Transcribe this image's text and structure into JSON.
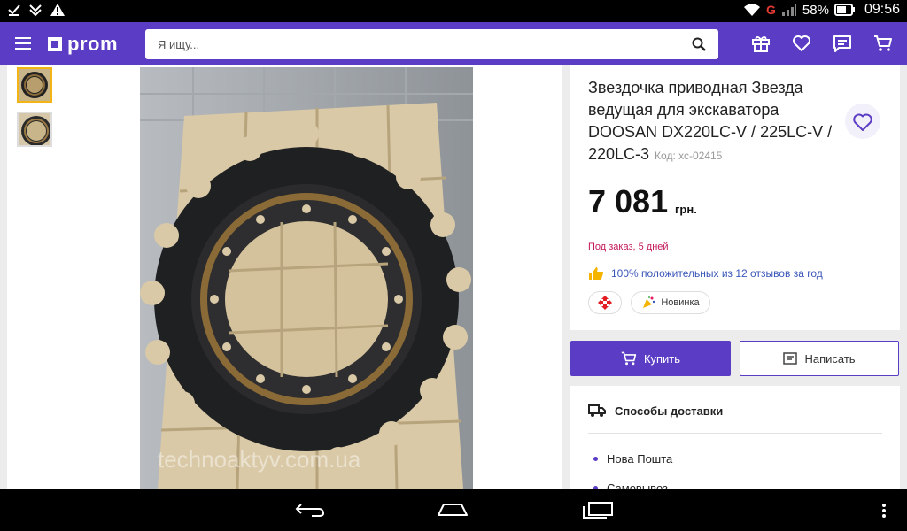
{
  "status_bar": {
    "battery": "58%",
    "time": "09:56",
    "network": "G"
  },
  "header": {
    "logo": "prom",
    "search": {
      "placeholder": "Я ищу..."
    },
    "icons": [
      "menu-icon",
      "gift-icon",
      "heart-icon",
      "chat-icon",
      "cart-icon"
    ],
    "accent_color": "#5b3cc4"
  },
  "gallery": {
    "thumbnails": [
      "sprocket-photo-1",
      "sprocket-photo-2"
    ],
    "watermark": "technoaktyv.com.ua"
  },
  "product": {
    "title": "Звездочка приводная Звезда ведущая для экскаватора DOOSAN DX220LC-V / 225LC-V / 220LC-3",
    "code": "Код: хс-02415",
    "price": "7 081",
    "currency": "грн.",
    "availability": "Под заказ, 5 дней",
    "reviews": "100% положительных из 12 отзывов за год",
    "badge_new": "Новинка"
  },
  "actions": {
    "buy": "Купить",
    "write": "Написать"
  },
  "delivery": {
    "title": "Способы доставки",
    "items": [
      "Нова Пошта",
      "Самовывоз"
    ]
  }
}
